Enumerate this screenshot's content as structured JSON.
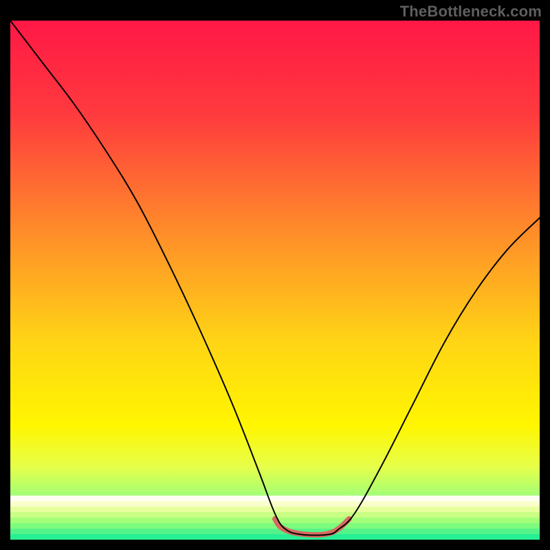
{
  "watermark": "TheBottleneck.com",
  "chart_data": {
    "type": "line",
    "title": "",
    "xlabel": "",
    "ylabel": "",
    "xlim": [
      0,
      100
    ],
    "ylim": [
      0,
      100
    ],
    "background_gradient_stops": [
      {
        "offset": 0,
        "color": "#ff1846"
      },
      {
        "offset": 18,
        "color": "#ff3a3e"
      },
      {
        "offset": 40,
        "color": "#ff8a2a"
      },
      {
        "offset": 62,
        "color": "#ffd515"
      },
      {
        "offset": 78,
        "color": "#fff600"
      },
      {
        "offset": 86,
        "color": "#e6ff4a"
      },
      {
        "offset": 92,
        "color": "#9dff7a"
      },
      {
        "offset": 100,
        "color": "#26ef94"
      }
    ],
    "bottom_band": {
      "from_y": 92,
      "to_y": 100,
      "stripes": [
        "#fffef2",
        "#fafecb",
        "#e8ff9e",
        "#c9ff84",
        "#a3ff7a",
        "#7dfb7e",
        "#54f38a",
        "#26ef94"
      ]
    },
    "series": [
      {
        "name": "bottleneck-curve",
        "color": "#000000",
        "width": 2,
        "points": [
          {
            "x": 0,
            "y": 100
          },
          {
            "x": 6,
            "y": 92
          },
          {
            "x": 12,
            "y": 84
          },
          {
            "x": 18,
            "y": 75
          },
          {
            "x": 24,
            "y": 65
          },
          {
            "x": 30,
            "y": 53
          },
          {
            "x": 36,
            "y": 40
          },
          {
            "x": 42,
            "y": 26
          },
          {
            "x": 47,
            "y": 13
          },
          {
            "x": 50,
            "y": 5
          },
          {
            "x": 52,
            "y": 2
          },
          {
            "x": 55,
            "y": 1
          },
          {
            "x": 60,
            "y": 1
          },
          {
            "x": 62,
            "y": 2
          },
          {
            "x": 65,
            "y": 5
          },
          {
            "x": 70,
            "y": 14
          },
          {
            "x": 76,
            "y": 26
          },
          {
            "x": 82,
            "y": 38
          },
          {
            "x": 88,
            "y": 48
          },
          {
            "x": 94,
            "y": 56
          },
          {
            "x": 100,
            "y": 62
          }
        ]
      },
      {
        "name": "flat-bottom-highlight",
        "color": "#d66a5f",
        "width": 8,
        "points": [
          {
            "x": 50,
            "y": 4
          },
          {
            "x": 51,
            "y": 2.5
          },
          {
            "x": 53,
            "y": 1.5
          },
          {
            "x": 56,
            "y": 1
          },
          {
            "x": 59,
            "y": 1
          },
          {
            "x": 61,
            "y": 1.5
          },
          {
            "x": 62.5,
            "y": 2.5
          },
          {
            "x": 64,
            "y": 4
          }
        ]
      }
    ]
  }
}
